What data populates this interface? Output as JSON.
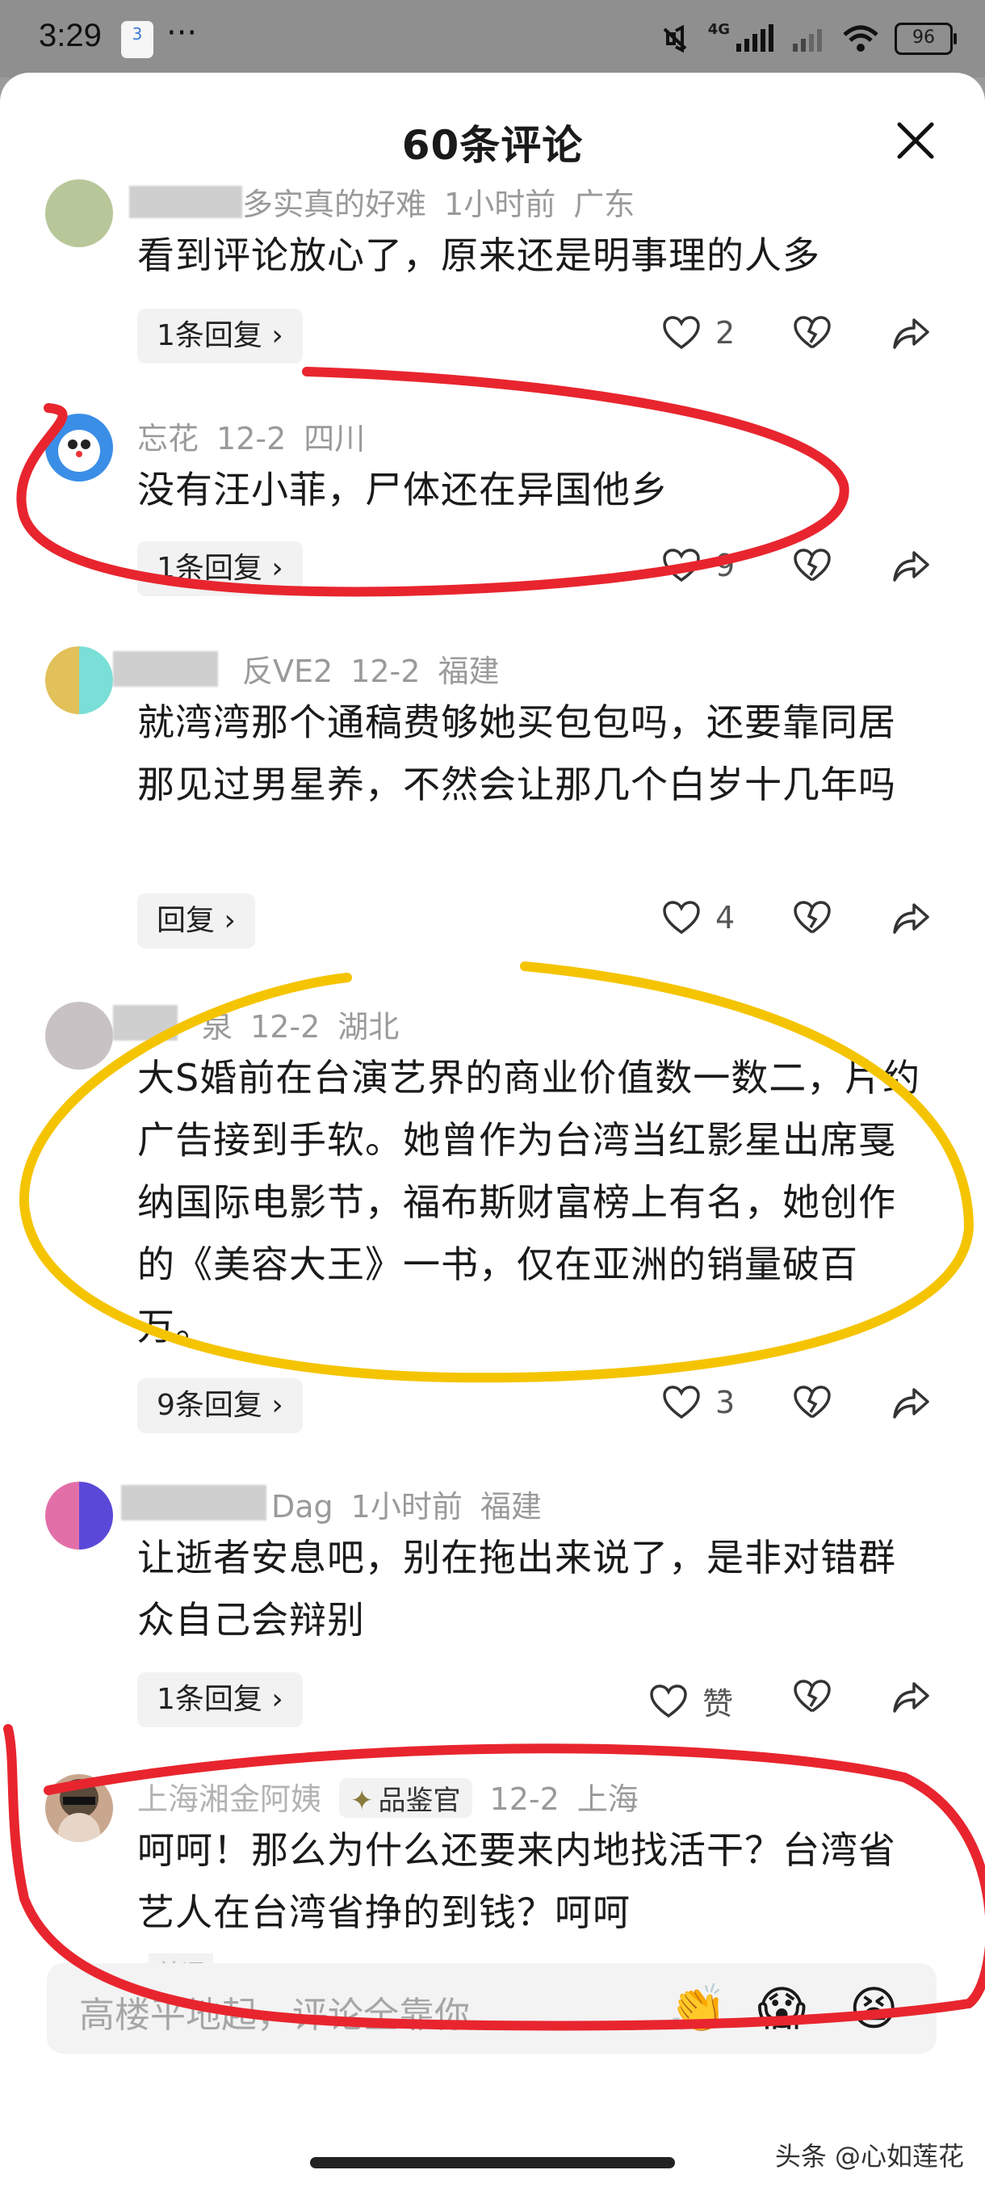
{
  "status_bar": {
    "time": "3:29",
    "app_badge": "3",
    "more": "···",
    "network": "4G",
    "battery": "96"
  },
  "sheet": {
    "title": "60条评论"
  },
  "comments": [
    {
      "user": "多实真的好难",
      "time": "1小时前",
      "location": "广东",
      "text": "看到评论放心了，原来还是明事理的人多",
      "reply_label": "1条回复",
      "likes": "2"
    },
    {
      "user": "忘花",
      "time": "12-2",
      "location": "四川",
      "text": "没有汪小菲，尸体还在异国他乡",
      "reply_label": "1条回复",
      "likes": "9"
    },
    {
      "user": "反VE2",
      "time": "12-2",
      "location": "福建",
      "text": "就湾湾那个通稿费够她买包包吗，还要靠同居那见过男星养，不然会让那几个白岁十几年吗",
      "reply_label": "回复",
      "likes": "4"
    },
    {
      "user": "泉",
      "time": "12-2",
      "location": "湖北",
      "text": "大S婚前在台演艺界的商业价值数一数二，片约广告接到手软。她曾作为台湾当红影星出席戛纳国际电影节，福布斯财富榜上有名，她创作的《美容大王》一书，仅在亚洲的销量破百万。",
      "reply_label": "9条回复",
      "likes": "3"
    },
    {
      "user": "Dag",
      "time": "1小时前",
      "location": "福建",
      "text": "让逝者安息吧，别在拖出来说了，是非对错群众自己会辩别",
      "reply_label": "1条回复",
      "likes": "赞"
    },
    {
      "user": "上海湘金阿姨",
      "badge": "品鉴官",
      "time": "12-2",
      "location": "上海",
      "text": "呵呵！那么为什么还要来内地找活干？台湾省艺人在台湾省挣的到钱？呵呵",
      "reply_label": "首评"
    }
  ],
  "input": {
    "placeholder": "高楼平地起，评论全靠你"
  },
  "emojis": [
    "👏",
    "😱",
    "😫"
  ],
  "watermark": "头条 @心如莲花",
  "annotation_colors": {
    "red": "#e8252e",
    "yellow": "#f5c400"
  }
}
